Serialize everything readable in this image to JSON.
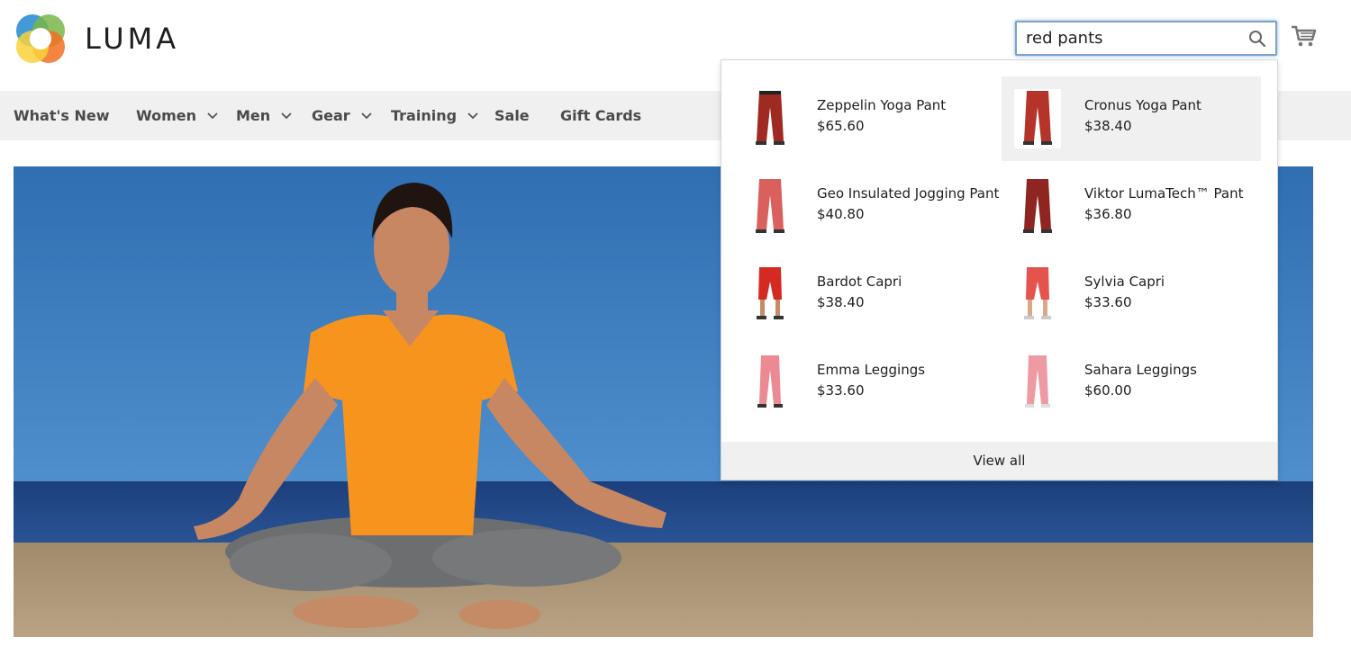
{
  "header": {
    "logo_text": "LUMA",
    "search": {
      "value": "red pants",
      "icon": "search-icon"
    },
    "cart_icon": "cart-icon"
  },
  "nav": {
    "items": [
      {
        "label": "What's New",
        "has_dropdown": false
      },
      {
        "label": "Women",
        "has_dropdown": true
      },
      {
        "label": "Men",
        "has_dropdown": true
      },
      {
        "label": "Gear",
        "has_dropdown": true
      },
      {
        "label": "Training",
        "has_dropdown": true
      },
      {
        "label": "Sale",
        "has_dropdown": false
      },
      {
        "label": "Gift Cards",
        "has_dropdown": false
      }
    ]
  },
  "search_results": {
    "products": [
      {
        "name": "Zeppelin Yoga Pant",
        "price": "$65.60",
        "color": "#9e2a22"
      },
      {
        "name": "Cronus Yoga Pant",
        "price": "$38.40",
        "color": "#b5342a"
      },
      {
        "name": "Geo Insulated Jogging Pant",
        "price": "$40.80",
        "color": "#d9605c"
      },
      {
        "name": "Viktor LumaTech™ Pant",
        "price": "$36.80",
        "color": "#8e2520"
      },
      {
        "name": "Bardot Capri",
        "price": "$38.40",
        "color": "#d42a21"
      },
      {
        "name": "Sylvia Capri",
        "price": "$33.60",
        "color": "#e4544d"
      },
      {
        "name": "Emma Leggings",
        "price": "$33.60",
        "color": "#ec8a93"
      },
      {
        "name": "Sahara Leggings",
        "price": "$60.00",
        "color": "#ee9aa2"
      }
    ],
    "view_all_label": "View all"
  },
  "hero": {
    "image": "woman-meditating-on-beach"
  }
}
